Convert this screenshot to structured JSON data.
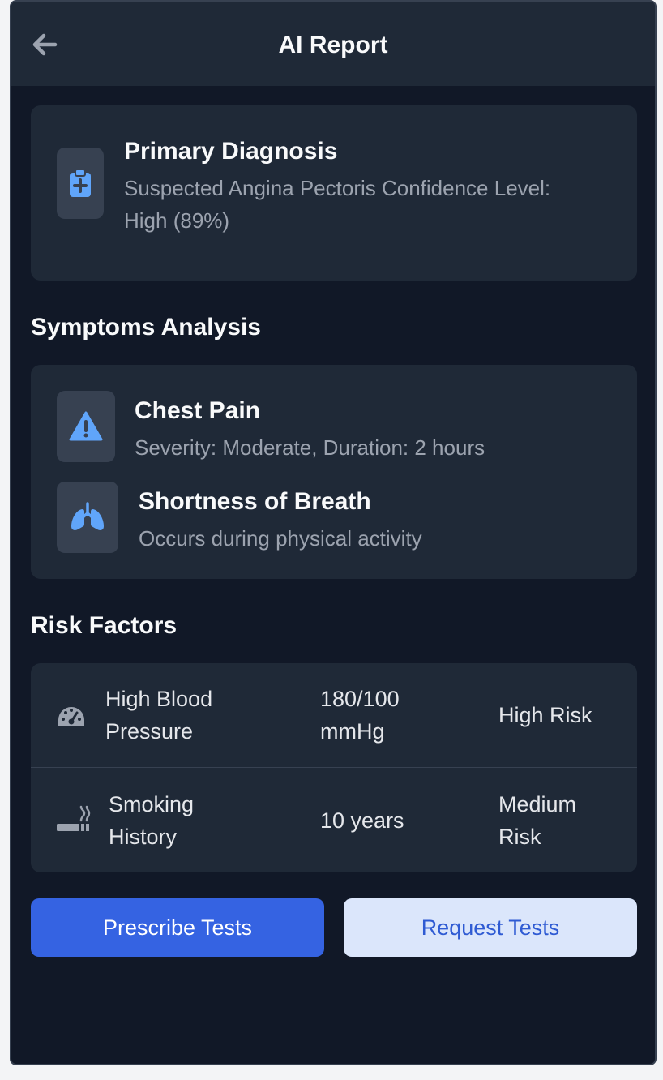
{
  "header": {
    "title": "AI Report",
    "back_icon": "arrow-left-icon"
  },
  "diagnosis": {
    "icon": "clipboard-medical-icon",
    "title": "Primary Diagnosis",
    "line1": "Suspected Angina Pectoris Confidence Level:",
    "line2": "High (89%)"
  },
  "symptoms": {
    "section_title": "Symptoms Analysis",
    "items": [
      {
        "icon": "warning-triangle-icon",
        "title": "Chest Pain",
        "detail": "Severity: Moderate, Duration: 2 hours"
      },
      {
        "icon": "lungs-icon",
        "title": "Shortness of Breath",
        "detail": "Occurs during physical activity"
      }
    ]
  },
  "risk_factors": {
    "section_title": "Risk Factors",
    "rows": [
      {
        "icon": "gauge-icon",
        "name_line1": "High Blood",
        "name_line2": "Pressure",
        "value_line1": "180/100",
        "value_line2": "mmHg",
        "risk_line1": "High Risk",
        "risk_line2": ""
      },
      {
        "icon": "smoking-icon",
        "name_line1": "Smoking",
        "name_line2": "History",
        "value_line1": "10 years",
        "value_line2": "",
        "risk_line1": "Medium",
        "risk_line2": "Risk"
      }
    ]
  },
  "actions": {
    "primary_label": "Prescribe Tests",
    "secondary_label": "Request Tests"
  },
  "colors": {
    "background": "#111827",
    "card": "#1f2937",
    "accent_blue": "#3563e2",
    "icon_blue": "#60a5fa",
    "light_button": "#dbe6fb"
  }
}
